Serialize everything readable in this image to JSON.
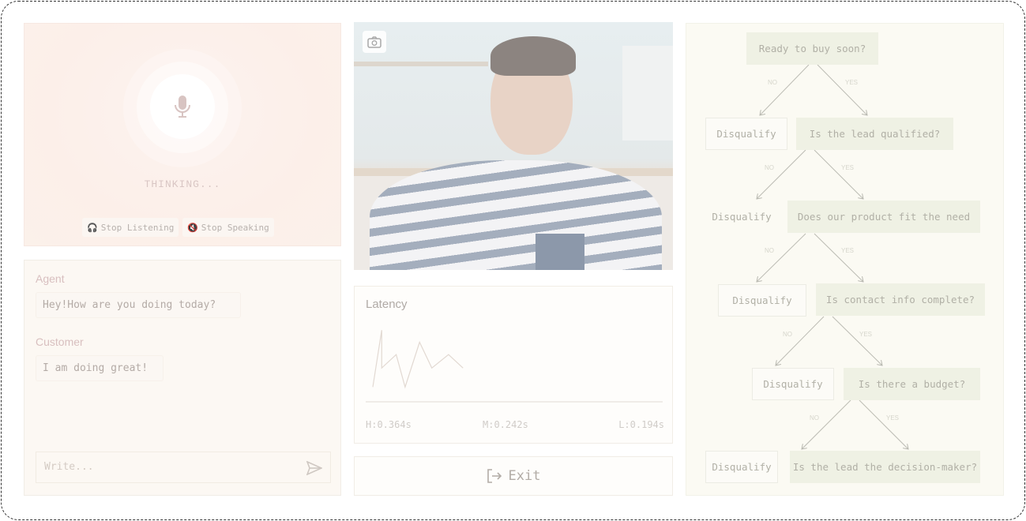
{
  "voice": {
    "status": "THINKING...",
    "stop_listening": "Stop Listening",
    "stop_speaking": "Stop Speaking"
  },
  "chat": {
    "messages": [
      {
        "role": "Agent",
        "text": "Hey!How are you doing today?"
      },
      {
        "role": "Customer",
        "text": "I am doing great!"
      }
    ],
    "input_placeholder": "Write..."
  },
  "latency": {
    "title": "Latency",
    "high": "H:0.364s",
    "mid": "M:0.242s",
    "low": "L:0.194s"
  },
  "chart_data": {
    "type": "line",
    "values": [
      0.194,
      0.364,
      0.251,
      0.291,
      0.194,
      0.328,
      0.251,
      0.291,
      0.251
    ],
    "ylim": [
      0.15,
      0.4
    ],
    "grid": false,
    "color": "#e2d9d2"
  },
  "exit_label": "Exit",
  "tree": {
    "branch_no": "NO",
    "branch_yes": "YES",
    "disqualify": "Disqualify",
    "questions": [
      "Ready to buy soon?",
      "Is the lead qualified?",
      "Does our product fit the need",
      "Is contact info complete?",
      "Is there a budget?",
      "Is the lead the decision-maker?"
    ]
  }
}
